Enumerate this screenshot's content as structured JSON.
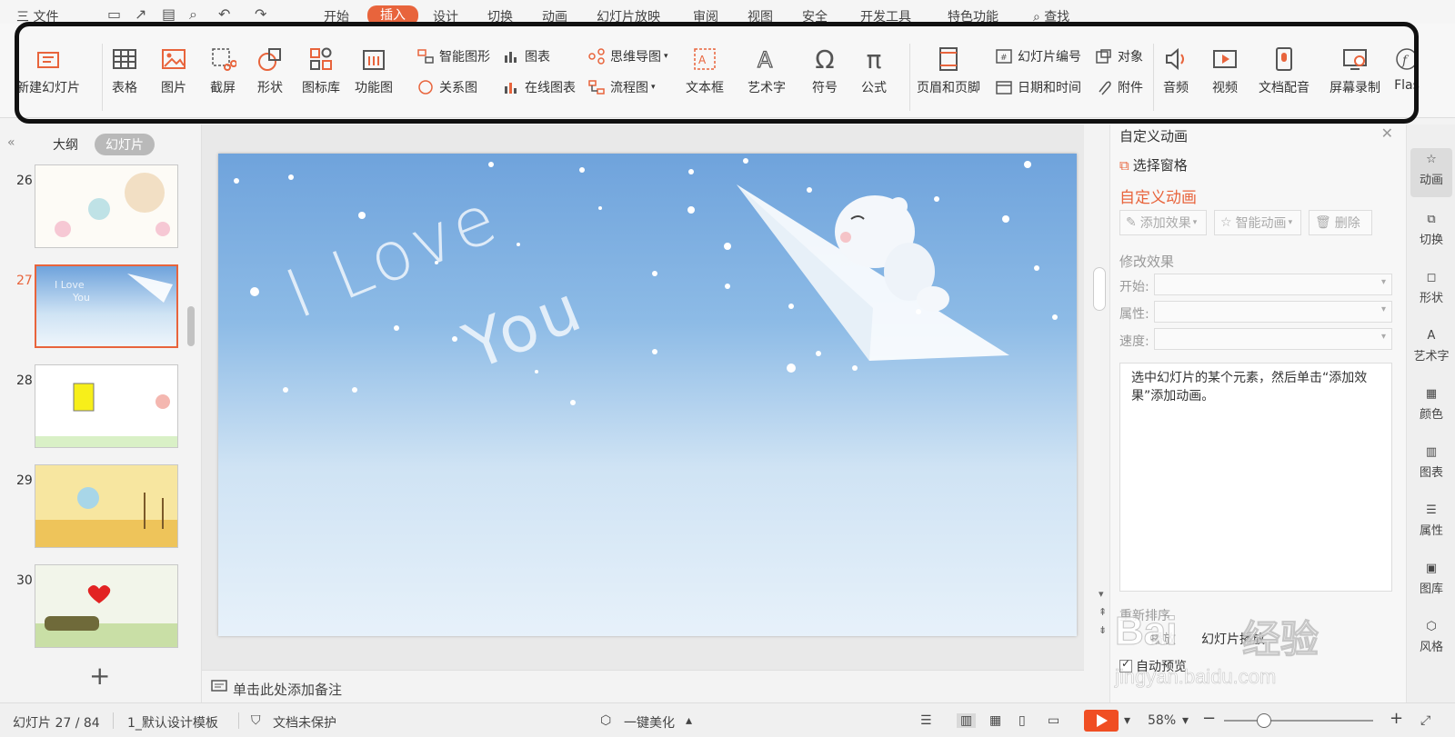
{
  "menubar": {
    "file": "三 文件",
    "tabs": [
      "开始",
      "插入",
      "设计",
      "切换",
      "动画",
      "幻灯片放映",
      "审阅",
      "视图",
      "安全",
      "开发工具",
      "特色功能"
    ],
    "active_tab": "插入",
    "search": "查找"
  },
  "ribbon": {
    "new_slide": "新建幻灯片",
    "table": "表格",
    "picture": "图片",
    "screenshot": "截屏",
    "shape": "形状",
    "icon_lib": "图标库",
    "func_chart": "功能图",
    "smart_art": "智能图形",
    "chart": "图表",
    "relation": "关系图",
    "online_chart": "在线图表",
    "mindmap": "思维导图",
    "flowchart": "流程图",
    "textbox": "文本框",
    "wordart": "艺术字",
    "symbol": "符号",
    "formula": "公式",
    "header_footer": "页眉和页脚",
    "slide_number": "幻灯片编号",
    "object": "对象",
    "date_time": "日期和时间",
    "attachment": "附件",
    "audio": "音频",
    "video": "视频",
    "doc_voice": "文档配音",
    "screen_record": "屏幕录制",
    "flash": "Flas"
  },
  "left_panel": {
    "tab_outline": "大纲",
    "tab_slides": "幻灯片",
    "slides": [
      {
        "num": "26"
      },
      {
        "num": "27"
      },
      {
        "num": "28"
      },
      {
        "num": "29"
      },
      {
        "num": "30"
      }
    ],
    "selected": "27"
  },
  "slide": {
    "line1": "I Love",
    "line2": "You"
  },
  "notes": {
    "placeholder": "单击此处添加备注"
  },
  "task_pane": {
    "title": "自定义动画",
    "select_pane": "选择窗格",
    "section": "自定义动画",
    "add_effect": "添加效果",
    "smart_anim": "智能动画",
    "delete": "删除",
    "modify": "修改效果",
    "start": "开始:",
    "property": "属性:",
    "speed": "速度:",
    "hint": "选中幻灯片的某个元素，然后单击“添加效果”添加动画。",
    "reorder": "重新排序",
    "play": "播放",
    "slide_play": "幻灯片播放",
    "auto_preview": "自动预览"
  },
  "right_strip": [
    "动画",
    "切换",
    "形状",
    "艺术字",
    "颜色",
    "图表",
    "属性",
    "图库",
    "风格"
  ],
  "status": {
    "slide_pos": "幻灯片 27 / 84",
    "template": "1_默认设计模板",
    "protect": "文档未保护",
    "beautify": "一键美化",
    "zoom": "58%"
  },
  "watermark": {
    "brand": "Bai",
    "brand2": "经验",
    "url": "jingyan.baidu.com"
  },
  "colors": {
    "accent": "#e8643c",
    "play": "#f04e23"
  }
}
